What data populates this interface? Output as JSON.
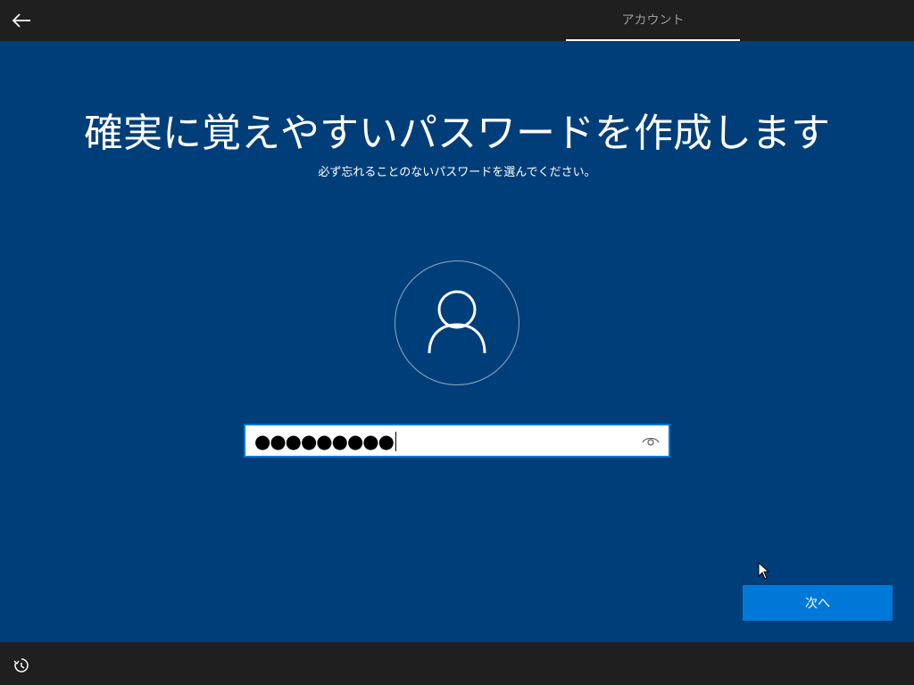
{
  "header": {
    "back_icon": "back-arrow-icon",
    "tab_label": "アカウント"
  },
  "main": {
    "title": "確実に覚えやすいパスワードを作成します",
    "subtitle": "必ず忘れることのないパスワードを選んでください。",
    "avatar_icon": "user-icon"
  },
  "password_field": {
    "masked_value": "●●●●●●●●●",
    "reveal_icon": "eye-icon"
  },
  "footer": {
    "next_label": "次へ",
    "ease_of_access_icon": "ease-of-access-icon"
  },
  "colors": {
    "background": "#003e7a",
    "bar": "#1f1f1f",
    "accent": "#0078d7"
  }
}
